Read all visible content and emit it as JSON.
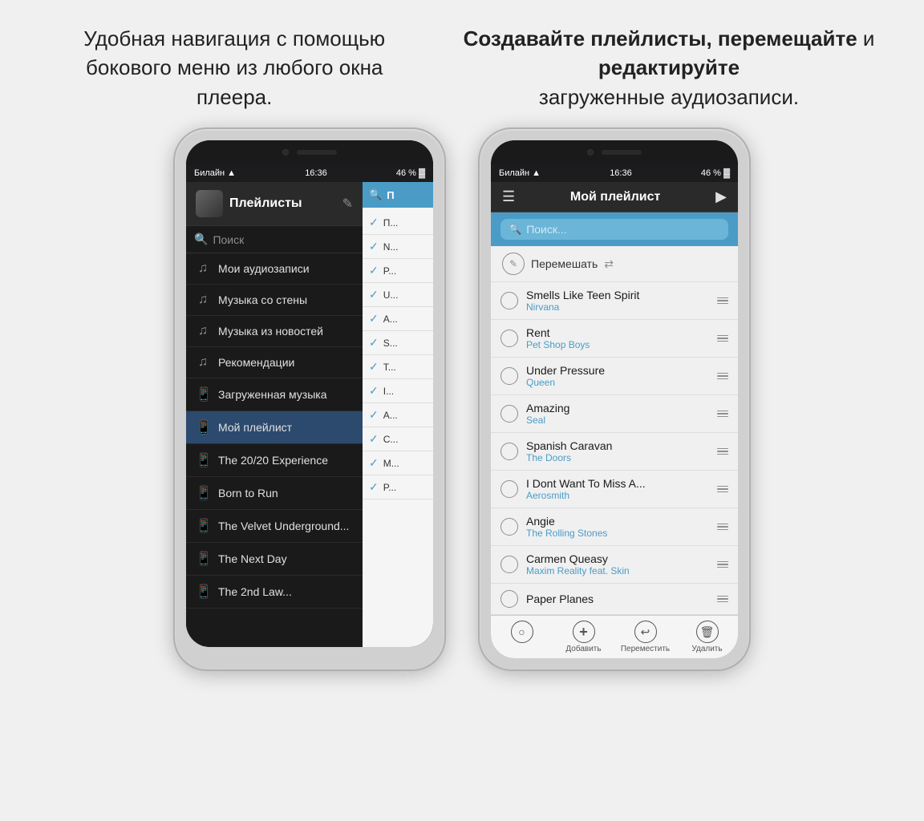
{
  "left_caption": "Удобная навигация с помощью бокового меню из любого окна плеера.",
  "right_caption_normal": "загруженные аудиозаписи.",
  "right_caption_bold": "Создавайте плейлисты, перемещайте",
  "right_caption_connector": " и ",
  "right_caption_bold2": "редактируйте",
  "status": {
    "carrier": "Билайн",
    "wifi": "WiFi",
    "time": "16:36",
    "battery": "46 %"
  },
  "left_phone": {
    "header_title": "Плейлисты",
    "search_placeholder": "Поиск",
    "sidebar_items": [
      {
        "id": "my-audio",
        "icon": "🎵",
        "label": "Мои аудиозаписи"
      },
      {
        "id": "wall-music",
        "icon": "🎵",
        "label": "Музыка со стены"
      },
      {
        "id": "news-music",
        "icon": "🎵",
        "label": "Музыка из новостей"
      },
      {
        "id": "recs",
        "icon": "🎵",
        "label": "Рекомендации"
      },
      {
        "id": "downloaded",
        "icon": "📱",
        "label": "Загруженная музыка"
      },
      {
        "id": "my-playlist",
        "icon": "📱",
        "label": "Мой плейлист",
        "active": true
      },
      {
        "id": "2020",
        "icon": "📱",
        "label": "The 20/20 Experience"
      },
      {
        "id": "born-to-run",
        "icon": "📱",
        "label": "Born to Run"
      },
      {
        "id": "velvet",
        "icon": "📱",
        "label": "The Velvet Underground..."
      },
      {
        "id": "next-day",
        "icon": "📱",
        "label": "The Next Day"
      },
      {
        "id": "2nd-law",
        "icon": "📱",
        "label": "The 2nd Law..."
      }
    ],
    "partial_items": [
      {
        "text": "П...",
        "checked": true
      },
      {
        "text": "N...",
        "checked": true
      },
      {
        "text": "P...",
        "checked": true
      },
      {
        "text": "U...",
        "checked": true
      },
      {
        "text": "A...",
        "checked": true
      },
      {
        "text": "S...",
        "checked": true
      },
      {
        "text": "T...",
        "checked": true
      },
      {
        "text": "I...",
        "checked": true
      },
      {
        "text": "A...",
        "checked": true
      },
      {
        "text": "C...",
        "checked": true
      },
      {
        "text": "M...",
        "checked": true
      },
      {
        "text": "P...",
        "checked": true
      }
    ]
  },
  "right_phone": {
    "nav_title": "Мой плейлист",
    "search_placeholder": "Поиск...",
    "shuffle_label": "Перемешать",
    "tracks": [
      {
        "name": "Smells Like Teen Spirit",
        "artist": "Nirvana"
      },
      {
        "name": "Rent",
        "artist": "Pet Shop Boys"
      },
      {
        "name": "Under Pressure",
        "artist": "Queen"
      },
      {
        "name": "Amazing",
        "artist": "Seal"
      },
      {
        "name": "Spanish Caravan",
        "artist": "The Doors"
      },
      {
        "name": "I Dont Want To Miss A...",
        "artist": "Aerosmith"
      },
      {
        "name": "Angie",
        "artist": "The Rolling Stones"
      },
      {
        "name": "Carmen Queasy",
        "artist": "Maxim Reality feat. Skin"
      },
      {
        "name": "Paper Planes",
        "artist": ""
      }
    ],
    "toolbar": [
      {
        "id": "add",
        "icon": "+",
        "label": "Добавить"
      },
      {
        "id": "move",
        "icon": "↩",
        "label": "Переместить"
      },
      {
        "id": "delete",
        "icon": "🗑",
        "label": "Удалить"
      }
    ]
  }
}
